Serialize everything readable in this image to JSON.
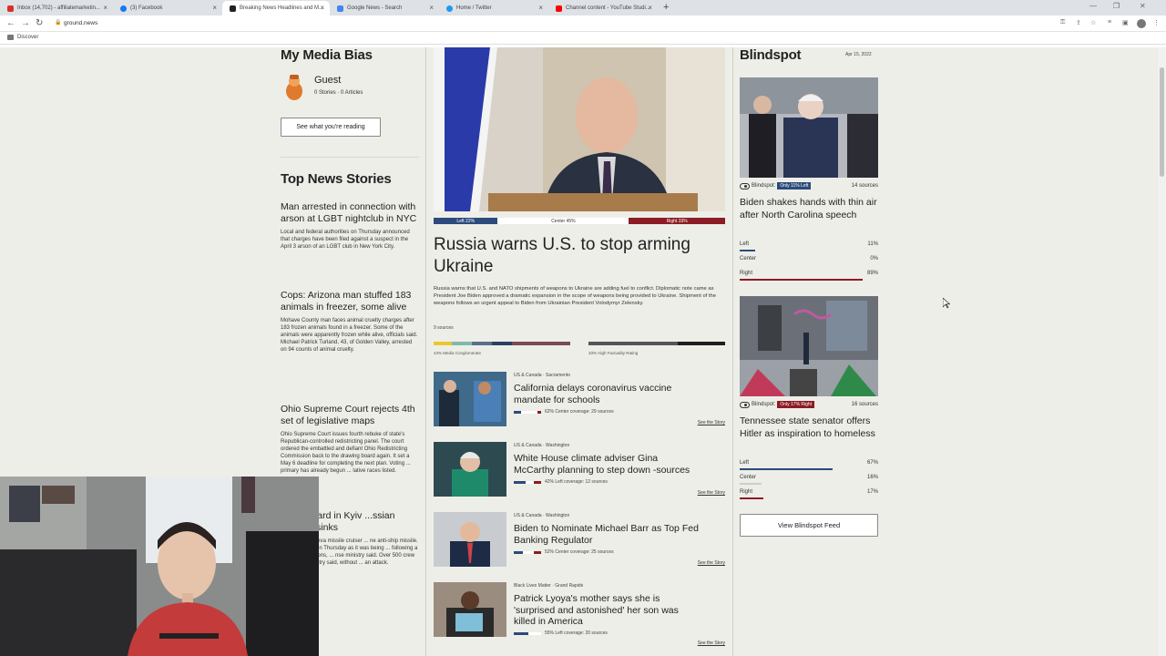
{
  "browser": {
    "tabs": [
      {
        "label": "Inbox (14,702) - affiliatemarketin...",
        "color": "#d93025"
      },
      {
        "label": "(3) Facebook",
        "color": "#1877f2"
      },
      {
        "label": "Breaking News Headlines and M...",
        "color": "#222222"
      },
      {
        "label": "Google News - Search",
        "color": "#4285f4"
      },
      {
        "label": "Home / Twitter",
        "color": "#1d9bf0"
      },
      {
        "label": "Channel content - YouTube Studi...",
        "color": "#ff0000"
      }
    ],
    "url": "ground.news",
    "bookmark": "Discover"
  },
  "left": {
    "bias_heading": "My Media Bias",
    "guest_name": "Guest",
    "guest_meta": "0 Stories · 0 Articles",
    "reading_button": "See what you're reading",
    "top_heading": "Top News Stories",
    "stories": [
      {
        "title": "Man arrested in connection with arson at LGBT nightclub in NYC",
        "text": "Local and federal authorities on Thursday announced that charges have been filed against a suspect in the April 3 arson of an LGBT club in New York City."
      },
      {
        "title": "Cops: Arizona man stuffed 183 animals in freezer, some alive",
        "text": "Mohave County man faces animal cruelty charges after 183 frozen animals found in a freezer. Some of the animals were apparently frozen while alive, officials said. Michael Patrick Turland, 43, of Golden Valley, arrested on 94 counts of animal cruelty."
      },
      {
        "title": "Ohio Supreme Court rejects 4th set of legislative maps",
        "text": "Ohio Supreme Court issues fourth rebuke of state's Republican-controlled redistricting panel. The court ordered the embattled and defiant Ohio Redistricting Commission back to the drawing board again. It set a May 6 deadline for completing the next plan. Voting ... primary has already begun ... lative races listed."
      },
      {
        "title": "...ons heard in Kyiv ...ssian warship sinks",
        "text": "... it hit the Moskva missile cruiser ... ne anti-ship missile. The Soviet- ... on Thursday as it was being ... following a fire and explosions, ... nse ministry said. Over 500 crew ... ted, the ministry said, without ... an attack."
      }
    ]
  },
  "center": {
    "bias": {
      "left": "Left 22%",
      "center": "Center 45%",
      "right": "Right 33%",
      "left_pct": 22,
      "center_pct": 45,
      "right_pct": 33
    },
    "title": "Russia warns U.S. to stop arming Ukraine",
    "summary": "Russia warns that U.S. and NATO shipments of weapons to Ukraine are adding fuel to conflict. Diplomatic note came as President Joe Biden approved a dramatic expansion in the scope of weapons being provided to Ukraine. Shipment of the weapons follows an urgent appeal to Biden from Ukrainian President Volodymyr Zelensky.",
    "sources": "9 sources",
    "ownership_label": "43% Media Conglomerate",
    "factuality_label": "33% High Factuality Rating",
    "items": [
      {
        "meta": "US & Canada · Sacramento",
        "title": "California delays coronavirus vaccine mandate for schools",
        "coverage": "62% Center coverage: 29 sources",
        "see": "See the Story"
      },
      {
        "meta": "US & Canada · Washington",
        "title": "White House climate adviser Gina McCarthy planning to step down -sources",
        "coverage": "42% Left coverage: 12 sources",
        "see": "See the Story"
      },
      {
        "meta": "US & Canada · Washington",
        "title": "Biden to Nominate Michael Barr as Top Fed Banking Regulator",
        "coverage": "52% Center coverage: 25 sources",
        "see": "See the Story"
      },
      {
        "meta": "Black Lives Matter · Grand Rapids",
        "title": "Patrick Lyoya's mother says she is 'surprised and astonished' her son was killed in America",
        "coverage": "55% Left coverage: 20 sources",
        "see": "See the Story"
      }
    ]
  },
  "right": {
    "heading": "Blindspot",
    "date": "Apr 15, 2022",
    "stories": [
      {
        "label": "Blindspot:",
        "pill": "Only 11% Left",
        "pill_color": "#2c4a7c",
        "sources": "14 sources",
        "title": "Biden shakes hands with thin air after North Carolina speech",
        "dist": [
          {
            "name": "Left",
            "val": "11%",
            "pct": 11,
            "color": "#2c4a7c"
          },
          {
            "name": "Center",
            "val": "0%",
            "pct": 0,
            "color": "#cccccc"
          },
          {
            "name": "Right",
            "val": "89%",
            "pct": 89,
            "color": "#8b1c25"
          }
        ]
      },
      {
        "label": "Blindspot:",
        "pill": "Only 17% Right",
        "pill_color": "#8b1c25",
        "sources": "16 sources",
        "title": "Tennessee state senator offers Hitler as inspiration to homeless",
        "dist": [
          {
            "name": "Left",
            "val": "67%",
            "pct": 67,
            "color": "#2c4a7c"
          },
          {
            "name": "Center",
            "val": "16%",
            "pct": 16,
            "color": "#cccccc"
          },
          {
            "name": "Right",
            "val": "17%",
            "pct": 17,
            "color": "#8b1c25"
          }
        ]
      }
    ],
    "feed_button": "View Blindspot Feed"
  },
  "colors": {
    "left": "#2c4a7c",
    "center": "#ffffff",
    "right": "#8b1c25"
  }
}
